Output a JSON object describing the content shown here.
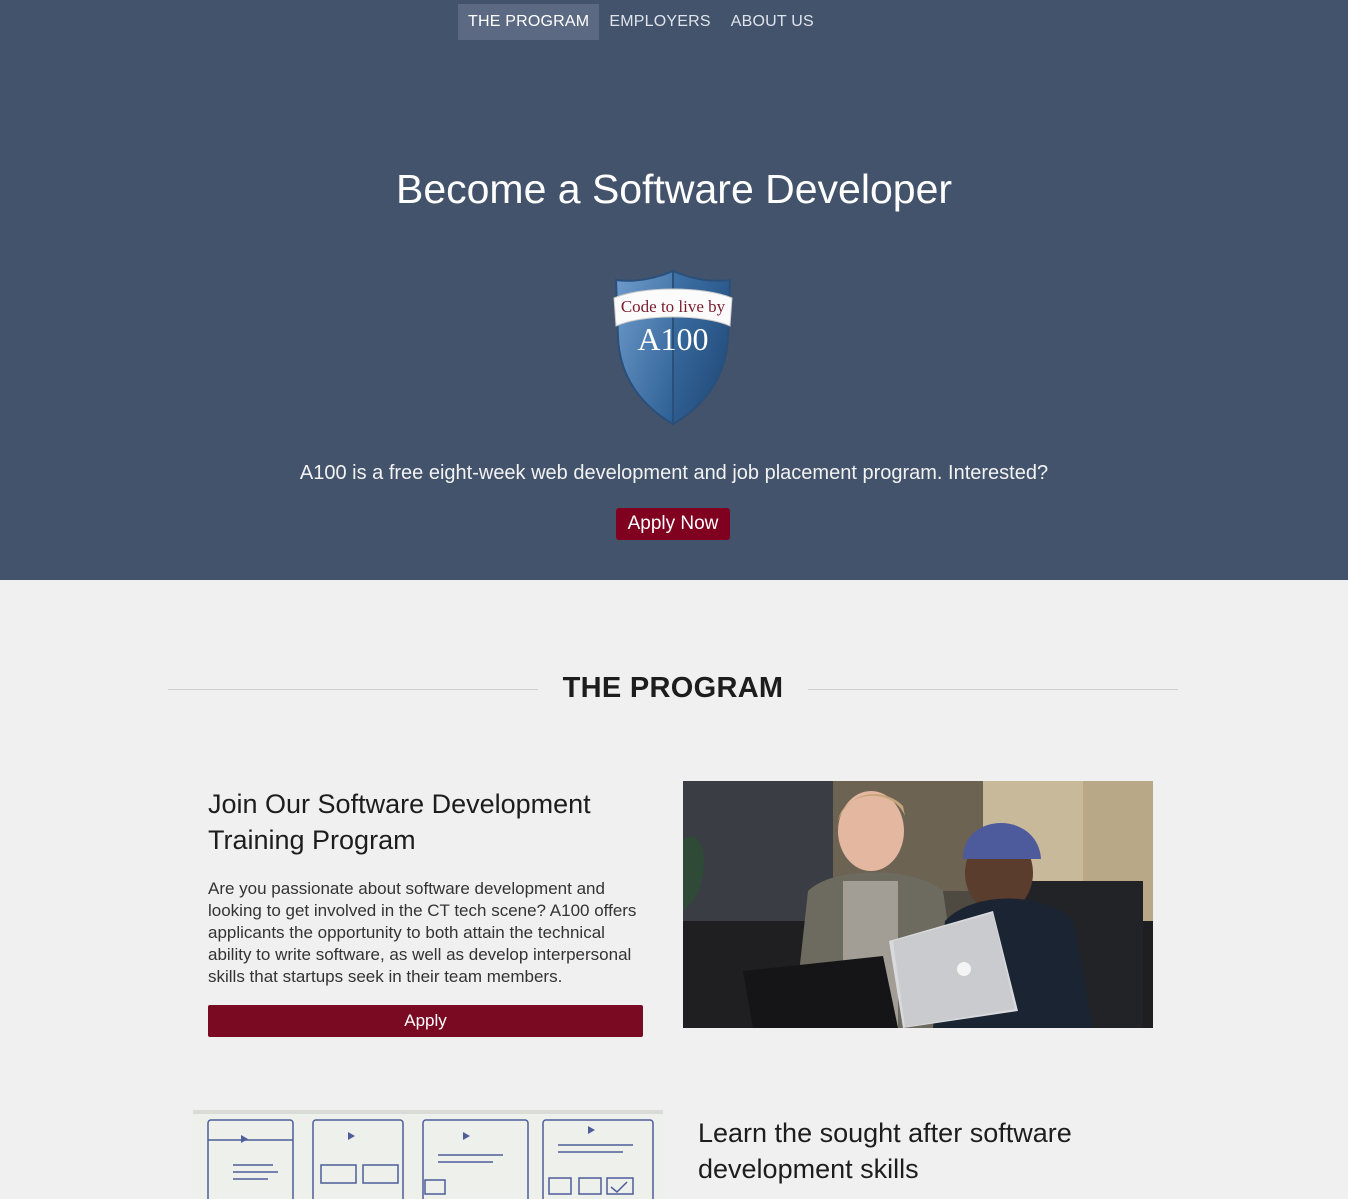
{
  "nav": {
    "items": [
      {
        "label": "THE PROGRAM",
        "active": true
      },
      {
        "label": "EMPLOYERS",
        "active": false
      },
      {
        "label": "ABOUT US",
        "active": false
      }
    ]
  },
  "hero": {
    "title": "Become a Software Developer",
    "logo": {
      "ribbon_text": "Code to live by",
      "mark_text": "A100"
    },
    "tagline": "A100 is a free eight-week web development and job placement program. Interested?",
    "apply_now_label": "Apply Now"
  },
  "program": {
    "section_title": "THE PROGRAM",
    "block1": {
      "heading": "Join Our Software Development Training Program",
      "body": "Are you passionate about software development and looking to get involved in the CT tech scene? A100 offers applicants the opportunity to both attain the technical ability to write software, as well as develop interpersonal skills that startups seek in their team members.",
      "apply_label": "Apply"
    },
    "block2": {
      "heading": "Learn the sought after software development skills"
    }
  },
  "colors": {
    "hero_bg": "#43536b",
    "nav_active_bg": "#5b6a82",
    "accent": "#800020",
    "page_bg": "#f0f0f0"
  }
}
